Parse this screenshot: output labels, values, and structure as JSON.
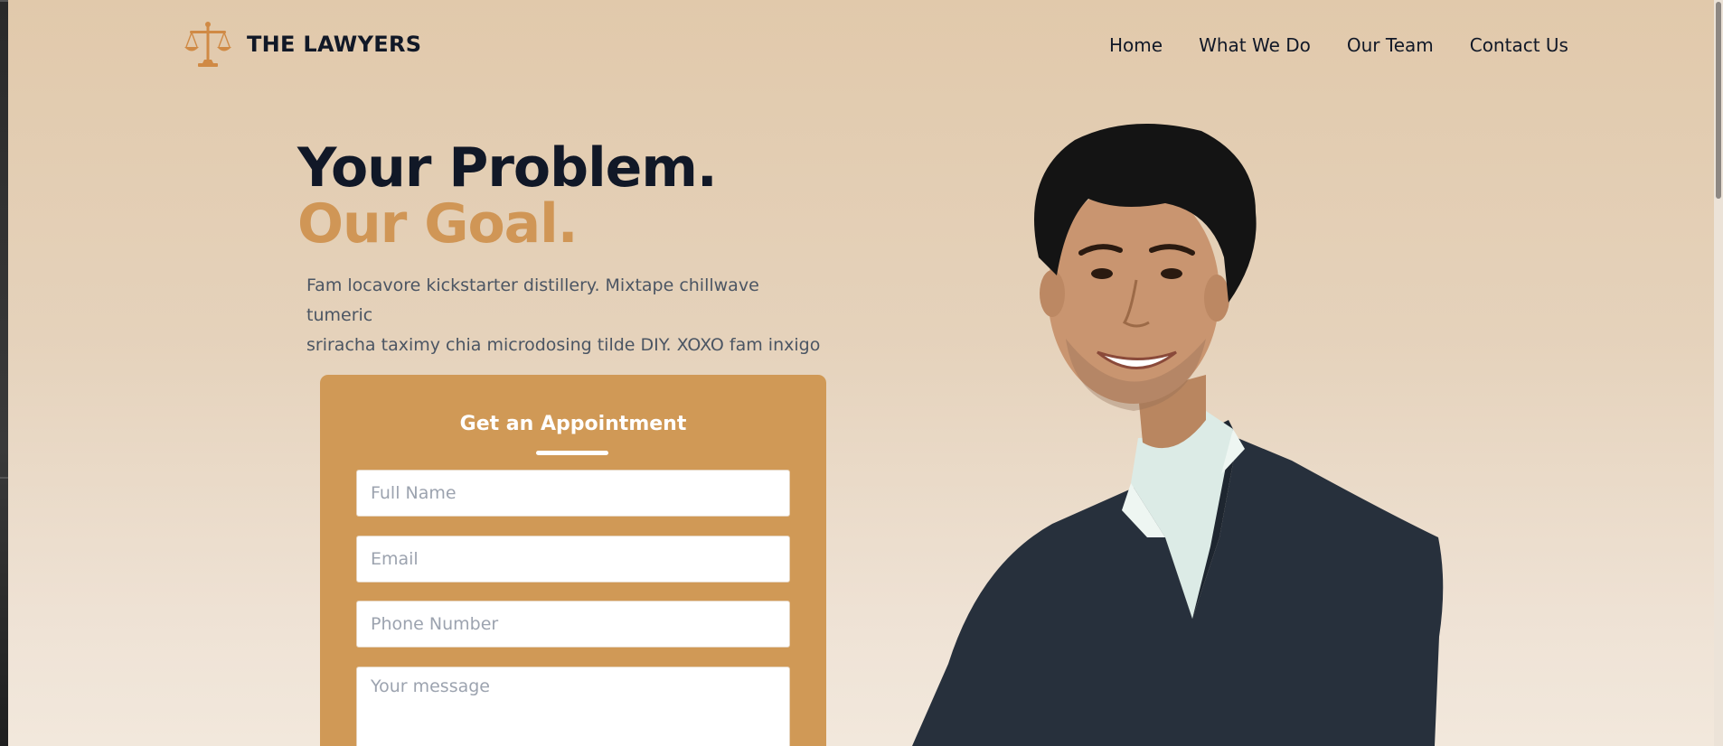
{
  "brand": {
    "name": "THE LAWYERS",
    "logo_icon": "scales-of-justice-icon",
    "accent_color": "#d09656"
  },
  "nav": {
    "items": [
      {
        "label": "Home"
      },
      {
        "label": "What We Do"
      },
      {
        "label": "Our Team"
      },
      {
        "label": "Contact Us"
      }
    ]
  },
  "hero": {
    "headline_line1": "Your Problem.",
    "headline_line2": "Our Goal.",
    "lead_line1": "Fam locavore kickstarter distillery. Mixtape chillwave tumeric",
    "lead_line2": "sriracha taximy chia microdosing tilde DIY. XOXO fam inxigo",
    "image": "smiling-man-in-suit-photo"
  },
  "appointment": {
    "title": "Get an Appointment",
    "card_color": "#d09956",
    "fields": {
      "name_placeholder": "Full Name",
      "email_placeholder": "Email",
      "phone_placeholder": "Phone Number",
      "message_placeholder": "Your message"
    }
  }
}
